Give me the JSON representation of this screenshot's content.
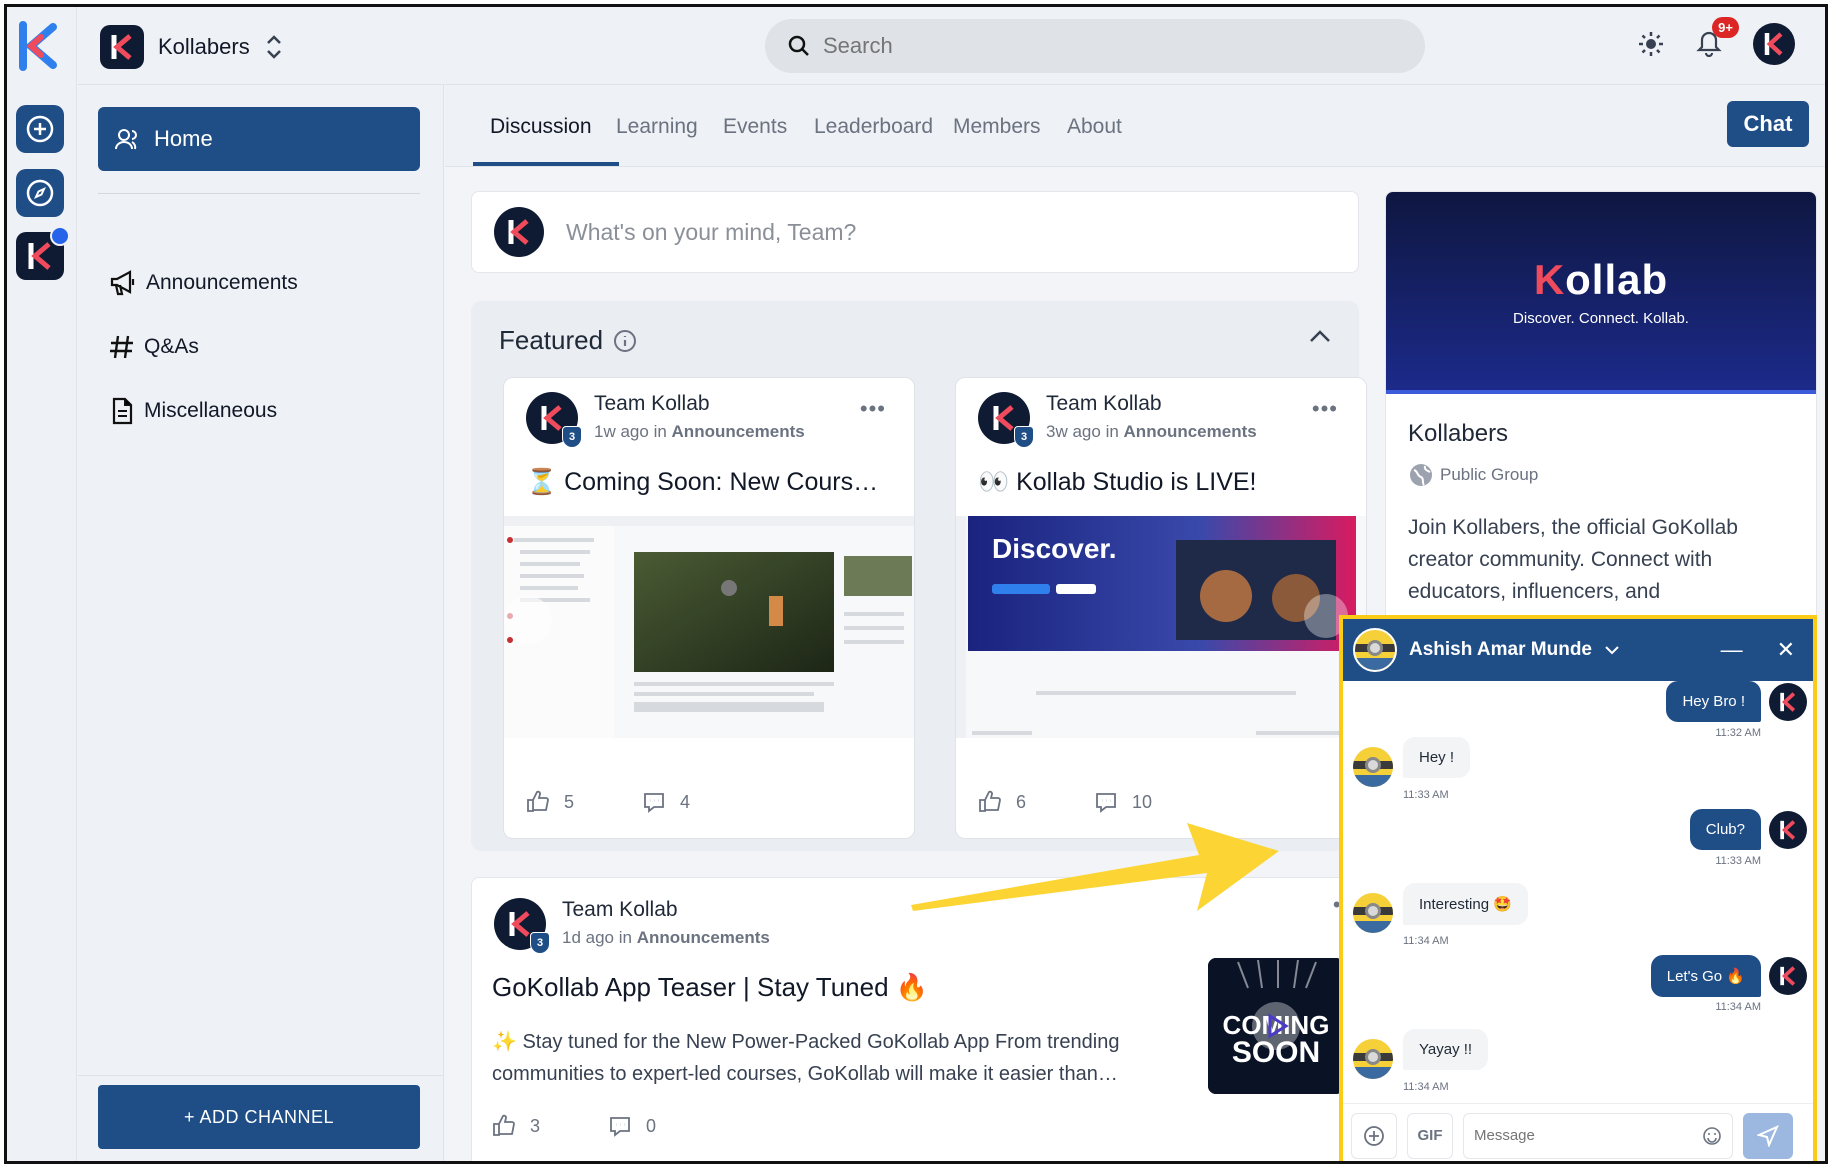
{
  "header": {
    "group_name": "Kollabers",
    "search_placeholder": "Search",
    "notif_badge": "9+"
  },
  "sidebar": {
    "home": "Home",
    "items": [
      {
        "label": "Announcements",
        "icon": "megaphone-icon"
      },
      {
        "label": "Q&As",
        "icon": "hash-icon"
      },
      {
        "label": "Miscellaneous",
        "icon": "document-icon"
      }
    ],
    "add_channel": "+ ADD CHANNEL"
  },
  "tabs": [
    "Discussion",
    "Learning",
    "Events",
    "Leaderboard",
    "Members",
    "About"
  ],
  "chat_button": "Chat",
  "composer": {
    "placeholder": "What's on your mind, Team?"
  },
  "featured": {
    "title": "Featured",
    "cards": [
      {
        "author": "Team Kollab",
        "time": "1w ago",
        "in": "in",
        "channel": "Announcements",
        "title": "⏳ Coming Soon: New Cours…",
        "likes": "5",
        "comments": "4",
        "level": "3"
      },
      {
        "author": "Team Kollab",
        "time": "3w ago",
        "in": "in",
        "channel": "Announcements",
        "title": "👀 Kollab Studio is LIVE!",
        "likes": "6",
        "comments": "10",
        "level": "3"
      }
    ],
    "card2_thumb_text": "Discover."
  },
  "post": {
    "author": "Team Kollab",
    "time": "1d ago",
    "in": "in",
    "channel": "Announcements",
    "title": "GoKollab App Teaser | Stay Tuned 🔥",
    "body": "✨ Stay tuned for the New Power-Packed GoKollab App From trending communities to expert-led courses, GoKollab will make it easier than…",
    "likes": "3",
    "comments": "0",
    "level": "3",
    "thumb_text_1": "COMING",
    "thumb_text_2": "SOON"
  },
  "about": {
    "banner_logo_k": "K",
    "banner_logo_rest": "ollab",
    "banner_tagline": "Discover. Connect. Kollab.",
    "name": "Kollabers",
    "visibility": "Public Group",
    "description": "Join Kollabers, the official GoKollab creator community. Connect with educators, influencers, and"
  },
  "chat": {
    "contact": "Ashish Amar Munde",
    "messages": [
      {
        "dir": "out",
        "text": "Hey Bro !",
        "time": "11:32 AM"
      },
      {
        "dir": "in",
        "text": "Hey !",
        "time": "11:33 AM"
      },
      {
        "dir": "out",
        "text": "Club?",
        "time": "11:33 AM"
      },
      {
        "dir": "in",
        "text": "Interesting 🤩",
        "time": "11:34 AM"
      },
      {
        "dir": "out",
        "text": "Let's Go 🔥",
        "time": "11:34 AM"
      },
      {
        "dir": "in",
        "text": "Yayay !!",
        "time": "11:34 AM"
      }
    ],
    "gif_label": "GIF",
    "message_placeholder": "Message"
  },
  "colors": {
    "brand": "#1f4e87",
    "dark": "#0f1b33",
    "accent_red": "#ef4b5c",
    "highlight": "#facc15"
  }
}
